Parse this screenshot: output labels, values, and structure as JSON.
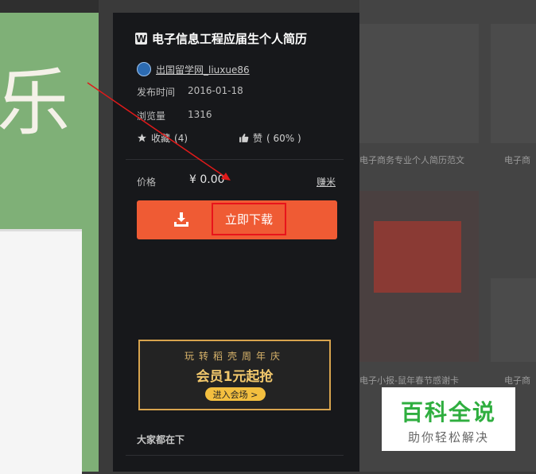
{
  "left_art": {
    "character": "乐"
  },
  "gallery": {
    "captions": [
      "电子商务专业个人简历范文",
      "电子商",
      "电子小报-鼠年春节感谢卡",
      "电子商"
    ]
  },
  "panel": {
    "title": "电子信息工程应届生个人简历",
    "title_icon": "W",
    "author": "出国留学网_liuxue86",
    "publish_label": "发布时间",
    "publish_date": "2016-01-18",
    "views_label": "浏览量",
    "views_value": "1316",
    "favorite_label": "收藏",
    "favorite_count": "(4)",
    "like_label": "赞",
    "like_pct": "( 60% )",
    "price_label": "价格",
    "price_value": "¥ 0.00",
    "earn_link": "赚米",
    "download_label": "立即下载",
    "banner_line1": "玩转稻壳周年庆",
    "banner_line2": "会员1元起抢",
    "banner_button": "进入会场 >",
    "section_heading": "大家都在下"
  },
  "watermark": {
    "title": "百科全说",
    "subtitle": "助你轻松解决"
  },
  "colors": {
    "accent": "#ef5b34",
    "highlight": "#e8141b",
    "panel": "#17181b",
    "banner_gold": "#f3bf3f"
  }
}
